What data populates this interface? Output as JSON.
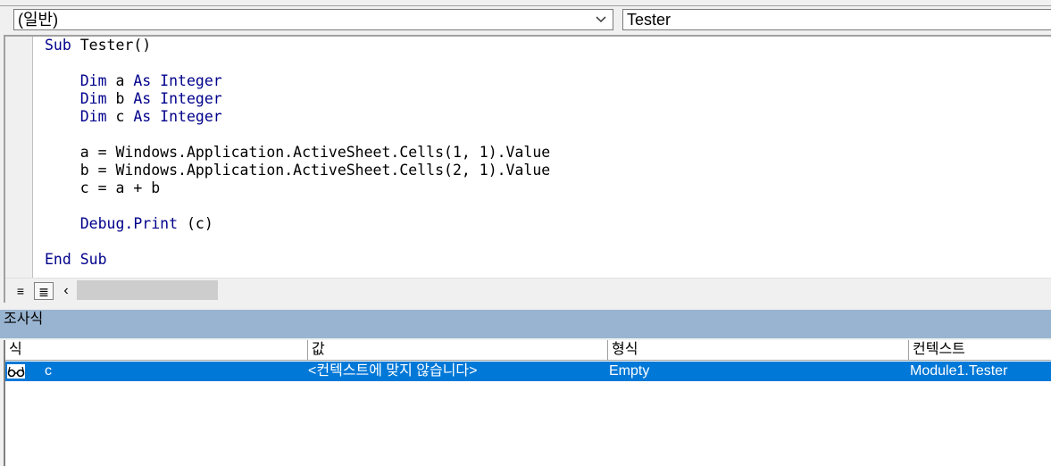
{
  "object_combo": {
    "value": "(일반)"
  },
  "procedure_combo": {
    "value": "Tester"
  },
  "code_lines": [
    [
      {
        "t": "Sub",
        "k": 1
      },
      {
        "t": " Tester()"
      }
    ],
    [],
    [
      {
        "t": "    "
      },
      {
        "t": "Dim",
        "k": 1
      },
      {
        "t": " a "
      },
      {
        "t": "As Integer",
        "k": 1
      }
    ],
    [
      {
        "t": "    "
      },
      {
        "t": "Dim",
        "k": 1
      },
      {
        "t": " b "
      },
      {
        "t": "As Integer",
        "k": 1
      }
    ],
    [
      {
        "t": "    "
      },
      {
        "t": "Dim",
        "k": 1
      },
      {
        "t": " c "
      },
      {
        "t": "As Integer",
        "k": 1
      }
    ],
    [],
    [
      {
        "t": "    a = Windows.Application.ActiveSheet.Cells(1, 1).Value"
      }
    ],
    [
      {
        "t": "    b = Windows.Application.ActiveSheet.Cells(2, 1).Value"
      }
    ],
    [
      {
        "t": "    c = a + b"
      }
    ],
    [],
    [
      {
        "t": "    "
      },
      {
        "t": "Debug.Print",
        "k": 1
      },
      {
        "t": " (c)"
      }
    ],
    [],
    [
      {
        "t": "End Sub",
        "k": 1
      }
    ]
  ],
  "colors": {
    "keyword": "#00008b",
    "selection": "#0078d7",
    "watch_title_bg": "#99b4d1"
  },
  "watch": {
    "title": "조사식",
    "columns": [
      "식",
      "값",
      "형식",
      "컨텍스트"
    ],
    "rows": [
      {
        "icon": "glasses-icon",
        "expression": "c",
        "value": "<컨텍스트에 맞지 않습니다>",
        "type": "Empty",
        "context": "Module1.Tester"
      }
    ]
  }
}
